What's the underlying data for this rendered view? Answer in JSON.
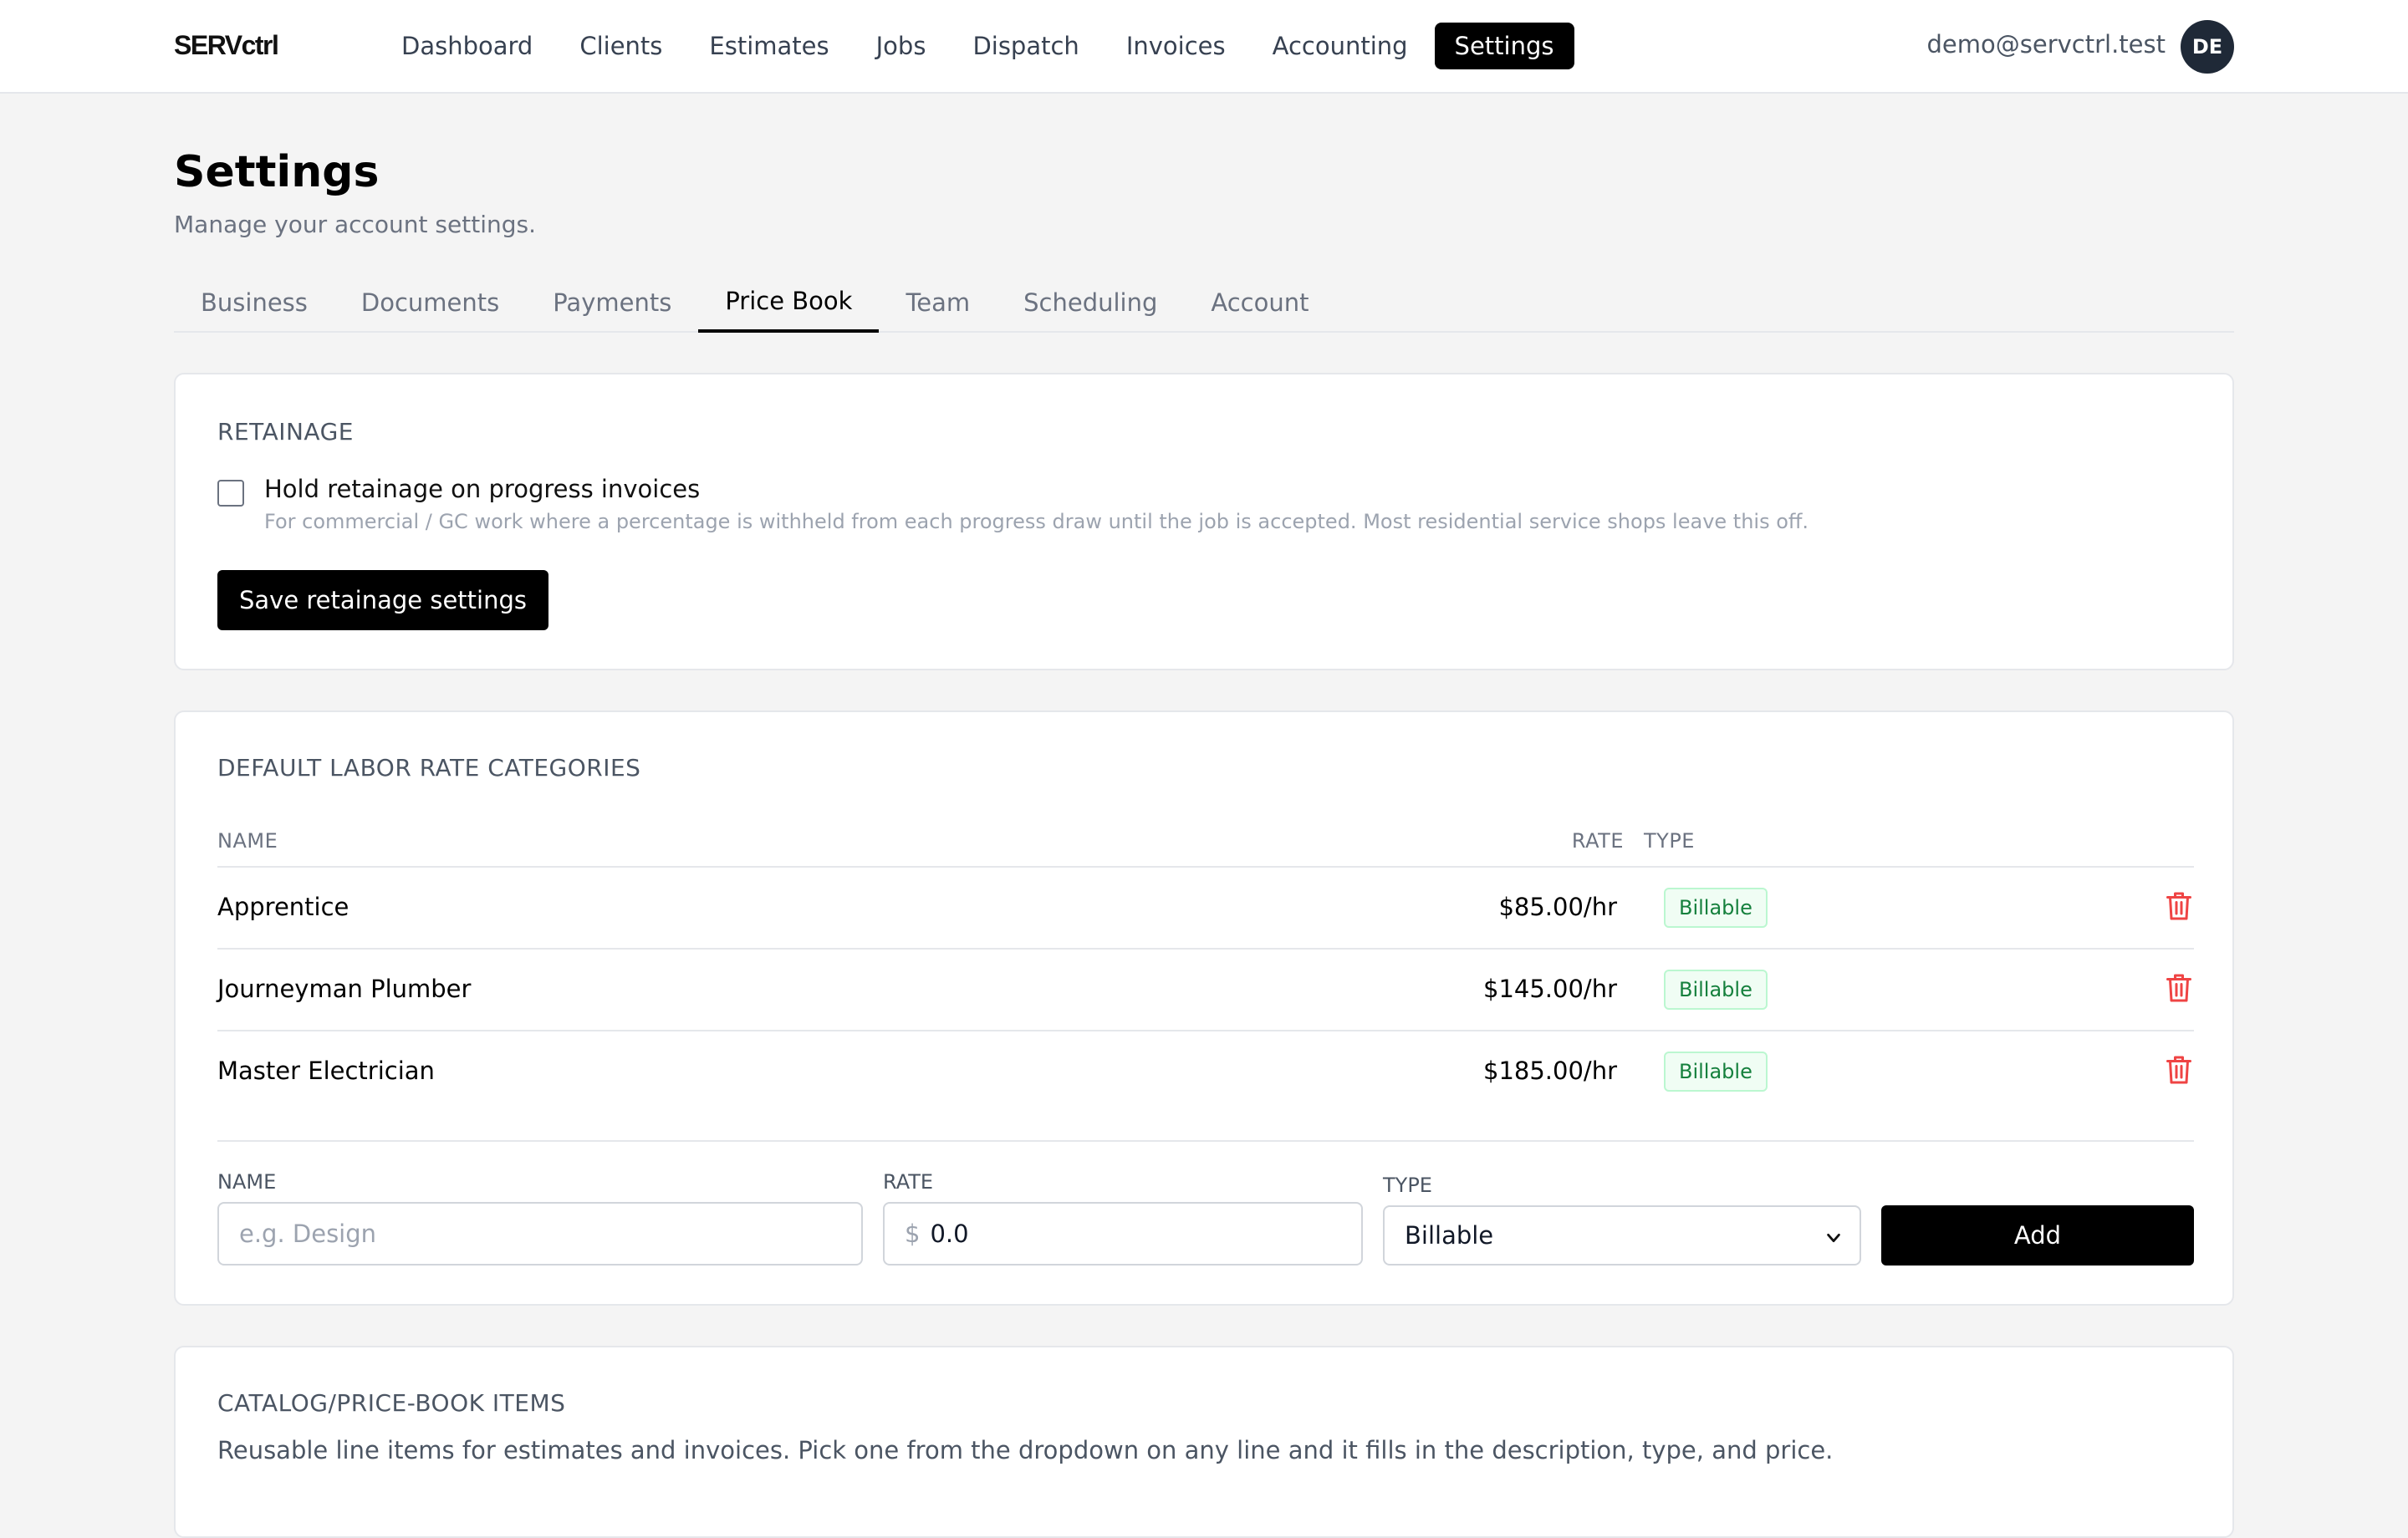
{
  "brand": {
    "name": "SERVctrl"
  },
  "nav": {
    "items": [
      {
        "label": "Dashboard"
      },
      {
        "label": "Clients"
      },
      {
        "label": "Estimates"
      },
      {
        "label": "Jobs"
      },
      {
        "label": "Dispatch"
      },
      {
        "label": "Invoices"
      },
      {
        "label": "Accounting"
      },
      {
        "label": "Settings",
        "active": true
      }
    ]
  },
  "user": {
    "email": "demo@servctrl.test",
    "initials": "DE"
  },
  "page": {
    "title": "Settings",
    "subtitle": "Manage your account settings."
  },
  "tabs": [
    {
      "label": "Business"
    },
    {
      "label": "Documents"
    },
    {
      "label": "Payments"
    },
    {
      "label": "Price Book",
      "active": true
    },
    {
      "label": "Team"
    },
    {
      "label": "Scheduling"
    },
    {
      "label": "Account"
    }
  ],
  "retainage": {
    "title": "RETAINAGE",
    "checkbox_label": "Hold retainage on progress invoices",
    "checked": false,
    "help": "For commercial / GC work where a percentage is withheld from each progress draw until the job is accepted. Most residential service shops leave this off.",
    "save_label": "Save retainage settings"
  },
  "labor": {
    "title": "DEFAULT LABOR RATE CATEGORIES",
    "headers": {
      "name": "NAME",
      "rate": "RATE",
      "type": "TYPE"
    },
    "rows": [
      {
        "name": "Apprentice",
        "rate": "$85.00/hr",
        "type": "Billable"
      },
      {
        "name": "Journeyman Plumber",
        "rate": "$145.00/hr",
        "type": "Billable"
      },
      {
        "name": "Master Electrician",
        "rate": "$185.00/hr",
        "type": "Billable"
      }
    ],
    "form": {
      "name_label": "NAME",
      "name_placeholder": "e.g. Design",
      "rate_label": "RATE",
      "rate_prefix": "$",
      "rate_value": "0.0",
      "type_label": "TYPE",
      "type_value": "Billable",
      "add_label": "Add"
    }
  },
  "catalog": {
    "title": "CATALOG/PRICE-BOOK ITEMS",
    "help": "Reusable line items for estimates and invoices. Pick one from the dropdown on any line and it fills in the description, type, and price."
  },
  "colors": {
    "accent": "#000000",
    "badge_green": "#15803d",
    "danger": "#ef4444"
  }
}
